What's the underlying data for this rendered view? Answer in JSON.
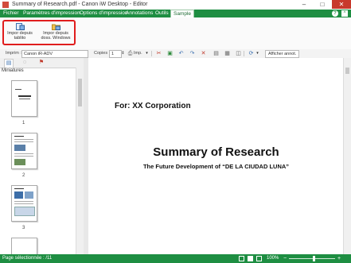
{
  "window": {
    "title": "Summary of Research.pdf - Canon iW Desktop - Editor",
    "controls": [
      "–",
      "□",
      "✕"
    ]
  },
  "menu": {
    "items": [
      {
        "label": "Fichier"
      },
      {
        "label": "Paramètres d'impression"
      },
      {
        "label": "Options d'impression"
      },
      {
        "label": "Annotations"
      },
      {
        "label": "Outils"
      },
      {
        "label": "Sample"
      }
    ],
    "help": "?",
    "minimize": "^"
  },
  "ribbon": {
    "buttons": [
      {
        "label": "Impor depuis tablito"
      },
      {
        "label": "Impor depuis doss. Windows"
      }
    ]
  },
  "toolbar": {
    "printer_label": "Imprim :",
    "printer_value": "Canon iR-ADV",
    "copies_label": "Copies :",
    "copies_value": "1",
    "print_label": "Imp.",
    "show_annotations": "Afficher annot."
  },
  "left_pane": {
    "header": "Miniatures",
    "thumbnails": [
      "1",
      "2",
      "3"
    ]
  },
  "document": {
    "for_line": "For: XX Corporation",
    "title": "Summary of Research",
    "subtitle": "The Future Development of “DE LA CIUDAD LUNA”"
  },
  "status": {
    "pages": "Page sélectionnée : /11",
    "zoom": "100%",
    "zoom_out": "−",
    "zoom_in": "+"
  },
  "colors": {
    "accent": "#1e8e42",
    "highlight_border": "#e01d1d"
  }
}
